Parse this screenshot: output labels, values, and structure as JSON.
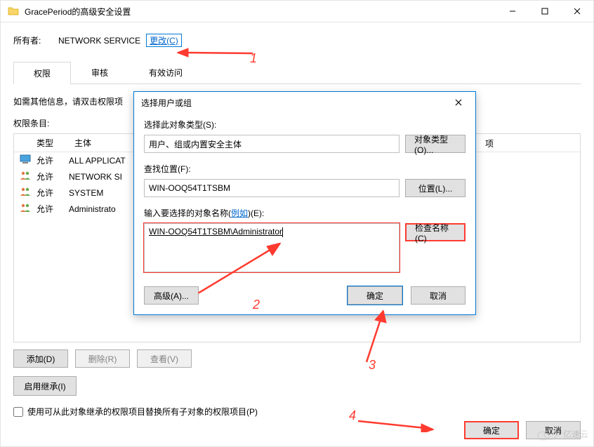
{
  "main_window": {
    "title": "GracePeriod的高级安全设置",
    "owner_label": "所有者:",
    "owner_value": "NETWORK SERVICE",
    "change_link": "更改(C)",
    "tabs": [
      "权限",
      "审核",
      "有效访问"
    ],
    "hint_text": "如需其他信息，请双击权限项",
    "perm_list_label": "权限条目:",
    "col_type": "类型",
    "col_principal": "主体",
    "extra_col": "项",
    "perm_rows": [
      {
        "icon": "computer",
        "allow": "允许",
        "principal": "ALL APPLICAT"
      },
      {
        "icon": "people",
        "allow": "允许",
        "principal": "NETWORK SI"
      },
      {
        "icon": "people",
        "allow": "允许",
        "principal": "SYSTEM"
      },
      {
        "icon": "people",
        "allow": "允许",
        "principal": "Administrato"
      }
    ],
    "add_btn": "添加(D)",
    "remove_btn": "删除(R)",
    "view_btn": "查看(V)",
    "inherit_btn": "启用继承(I)",
    "replace_checkbox_label": "使用可从此对象继承的权限项目替换所有子对象的权限项目(P)",
    "ok_btn": "确定",
    "cancel_btn": "取消"
  },
  "dialog": {
    "title": "选择用户或组",
    "obj_type_label": "选择此对象类型(S):",
    "obj_type_value": "用户、组或内置安全主体",
    "obj_type_btn": "对象类型(O)...",
    "location_label": "查找位置(F):",
    "location_value": "WIN-OOQ54T1TSBM",
    "location_btn": "位置(L)...",
    "obj_name_label_prefix": "输入要选择的对象名称(",
    "obj_name_label_link": "例如",
    "obj_name_label_suffix": ")(E):",
    "obj_name_value": "WIN-OOQ54T1TSBM\\Administrator",
    "check_btn": "检查名称(C)",
    "advanced_btn": "高级(A)...",
    "ok_btn": "确定",
    "cancel_btn": "取消"
  },
  "annotations": {
    "step1": "1",
    "step2": "2",
    "step3": "3",
    "step4": "4"
  },
  "watermark": "亿速云"
}
